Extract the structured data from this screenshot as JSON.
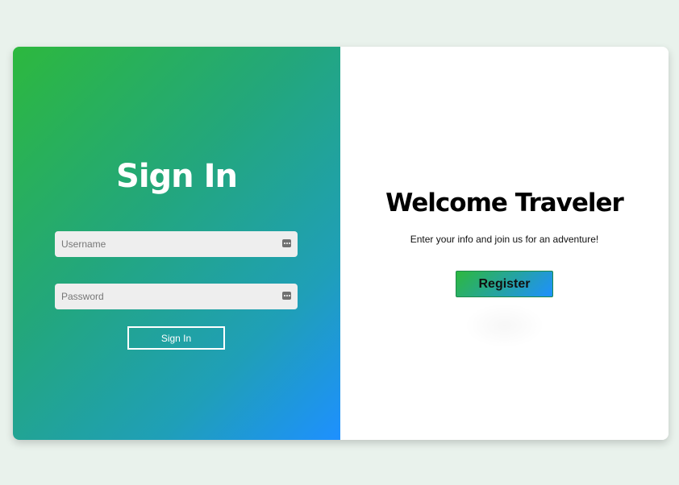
{
  "signin": {
    "title": "Sign In",
    "username_placeholder": "Username",
    "username_value": "",
    "password_placeholder": "Password",
    "password_value": "",
    "submit_label": "Sign In",
    "field_icon": "password-manager-icon"
  },
  "welcome": {
    "title": "Welcome Traveler",
    "text": "Enter your info and join us for an adventure!",
    "register_label": "Register"
  },
  "colors": {
    "background": "#e9f2ec",
    "gradient_start": "#2db83e",
    "gradient_end": "#1e90ff",
    "field_bg": "#eeeeee",
    "text_white": "#ffffff",
    "text_dark": "#000000"
  }
}
